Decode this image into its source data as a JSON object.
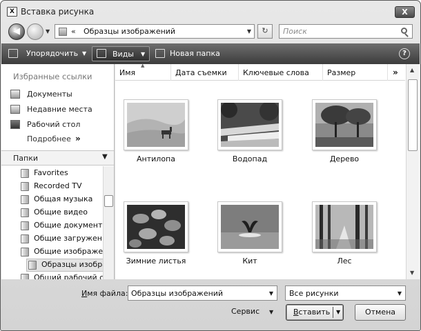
{
  "window": {
    "title": "Вставка рисунка",
    "close_glyph": "X"
  },
  "address": {
    "breadcrumb_chevron": "«",
    "path": "Образцы изображений",
    "dropdown_glyph": "▾",
    "refresh_glyph": "↻"
  },
  "search": {
    "placeholder": "Поиск"
  },
  "toolbar": {
    "organize_label": "Упорядочить",
    "views_label": "Виды",
    "new_folder_label": "Новая папка",
    "help_glyph": "?"
  },
  "favorites": {
    "header": "Избранные ссылки",
    "items": [
      {
        "label": "Документы",
        "icon": "documents-icon"
      },
      {
        "label": "Недавние места",
        "icon": "recent-places-icon"
      },
      {
        "label": "Рабочий стол",
        "icon": "desktop-icon"
      }
    ],
    "more_label": "Подробнее",
    "more_glyph": "»"
  },
  "folders": {
    "header": "Папки",
    "tree": [
      {
        "label": "Favorites",
        "icon": "folder-icon",
        "depth": 1
      },
      {
        "label": "Recorded TV",
        "icon": "folder-icon",
        "depth": 1
      },
      {
        "label": "Общая музыка",
        "icon": "music-folder-icon",
        "depth": 1
      },
      {
        "label": "Общие видео",
        "icon": "video-folder-icon",
        "depth": 1
      },
      {
        "label": "Общие документы",
        "icon": "documents-folder-icon",
        "depth": 1
      },
      {
        "label": "Общие загруженные",
        "icon": "downloads-folder-icon",
        "depth": 1
      },
      {
        "label": "Общие изображения",
        "icon": "pictures-folder-icon",
        "depth": 1
      },
      {
        "label": "Образцы изображений",
        "icon": "folder-icon",
        "depth": 2,
        "selected": true
      },
      {
        "label": "Общий рабочий стол",
        "icon": "desktop-folder-icon",
        "depth": 1
      }
    ]
  },
  "columns": [
    "Имя",
    "Дата съемки",
    "Ключевые слова",
    "Размер"
  ],
  "columns_more_glyph": "»",
  "files": [
    {
      "name": "Антилопа",
      "thumb": "antelope"
    },
    {
      "name": "Водопад",
      "thumb": "waterfall"
    },
    {
      "name": "Дерево",
      "thumb": "tree"
    },
    {
      "name": "Зимние листья",
      "thumb": "winter-leaves"
    },
    {
      "name": "Кит",
      "thumb": "whale"
    },
    {
      "name": "Лес",
      "thumb": "forest"
    }
  ],
  "form": {
    "filename_label_hotkey": "И",
    "filename_label_rest": "мя файла:",
    "filename_value": "Образцы изображений",
    "filter_value": "Все рисунки",
    "service_label": "Сервис",
    "insert_label_hotkey": "В",
    "insert_label_rest": "ставить",
    "cancel_label": "Отмена"
  }
}
